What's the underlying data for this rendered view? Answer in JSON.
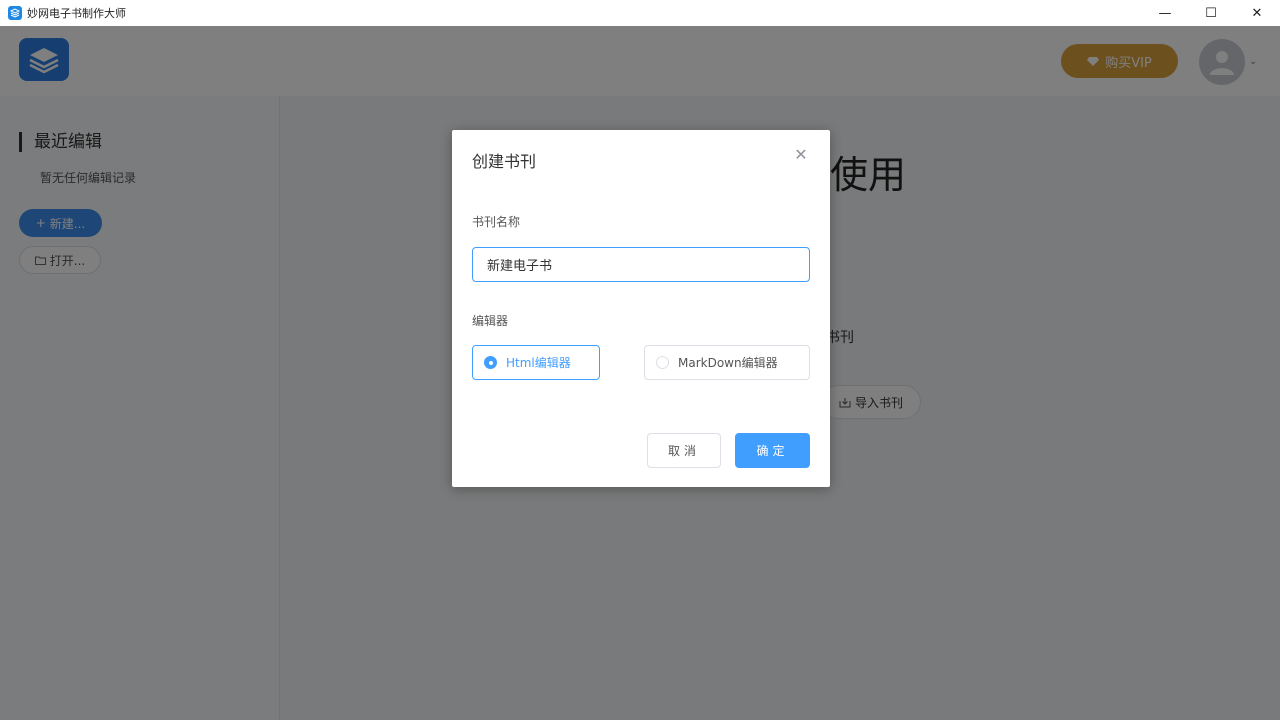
{
  "window": {
    "title": "妙网电子书制作大师",
    "minimize_glyph": "—",
    "maximize_glyph": "☐",
    "close_glyph": "✕"
  },
  "header": {
    "vip_label": "购买VIP",
    "vip_icon": "diamond-icon",
    "avatar_icon": "user-icon",
    "caret_glyph": "⌄"
  },
  "sidebar": {
    "recent_title": "最近编辑",
    "no_records": "暂无任何编辑记录",
    "new_label": "新建...",
    "new_glyph": "+",
    "open_label": "打开...",
    "open_icon": "folder-icon"
  },
  "main": {
    "welcome_fragment": "使用",
    "note_fragment": "书刊",
    "import_label": "导入书刊",
    "import_icon": "import-icon"
  },
  "dialog": {
    "title": "创建书刊",
    "close_glyph": "✕",
    "name_label": "书刊名称",
    "name_value": "新建电子书",
    "editor_label": "编辑器",
    "editor_options": [
      {
        "label": "Html编辑器",
        "selected": true
      },
      {
        "label": "MarkDown编辑器",
        "selected": false
      }
    ],
    "cancel_label": "取消",
    "ok_label": "确定"
  },
  "colors": {
    "primary": "#409eff",
    "vip": "#d9a23e",
    "logo": "#2c7de0",
    "overlay": "rgba(0,0,0,0.5)"
  }
}
